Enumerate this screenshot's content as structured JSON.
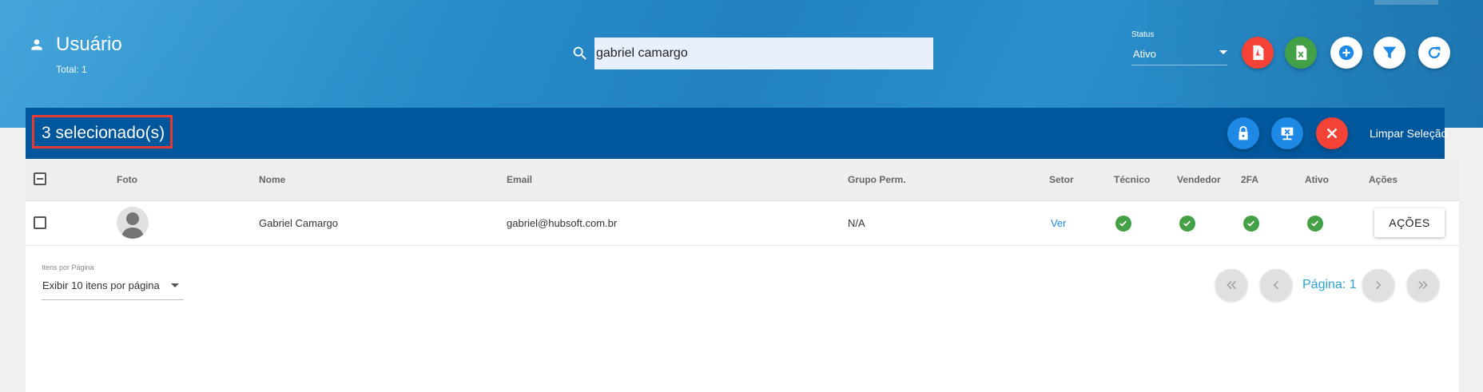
{
  "header": {
    "title": "Usuário",
    "total": "Total: 1",
    "search_value": "gabriel camargo",
    "status_label": "Status",
    "status_value": "Ativo",
    "icons": [
      "person-icon",
      "search-icon",
      "pdf-icon",
      "excel-icon",
      "add-icon",
      "filter-icon",
      "refresh-icon"
    ]
  },
  "selection": {
    "count_label": "3 selecionado(s)",
    "clear_label": "Limpar Seleção",
    "icons": [
      "lock-icon",
      "disconnect-icon",
      "close-icon"
    ]
  },
  "table": {
    "columns": [
      "Foto",
      "Nome",
      "Email",
      "Grupo Perm.",
      "Setor",
      "Técnico",
      "Vendedor",
      "2FA",
      "Ativo",
      "Ações"
    ],
    "rows": [
      {
        "nome": "Gabriel Camargo",
        "email": "gabriel@hubsoft.com.br",
        "grupo": "N/A",
        "setor": "Ver",
        "tecnico": true,
        "vendedor": true,
        "twofa": true,
        "ativo": true,
        "actions_label": "AÇÕES"
      }
    ]
  },
  "pagination": {
    "items_per_page_label": "Itens por Página",
    "items_per_page_value": "Exibir 10 itens por página",
    "page_label": "Página: 1"
  },
  "colors": {
    "header_blue": "#2a8fcb",
    "selection_bar": "#01579b",
    "pdf_red": "#f44336",
    "excel_green": "#43a047",
    "action_blue": "#1e88e5",
    "check_green": "#43a047",
    "highlight_red": "#e53935"
  }
}
